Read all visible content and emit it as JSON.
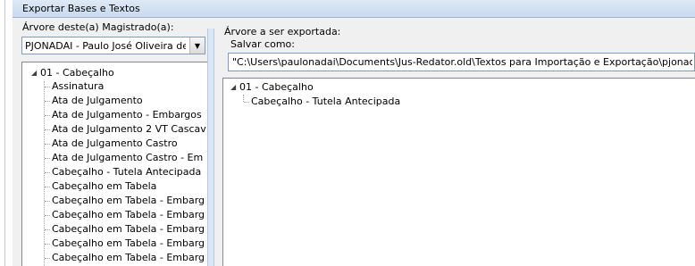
{
  "window": {
    "title": "Exportar Bases e Textos"
  },
  "left_panel": {
    "label": "Árvore deste(a) Magistrado(a):",
    "magistrate_select": {
      "value": "PJONADAI - Paulo José Oliveira de N"
    },
    "tree": {
      "root": "01 - Cabeçalho",
      "children": [
        "Assinatura",
        "Ata de Julgamento",
        "Ata de Julgamento - Embargos",
        "Ata de Julgamento 2 VT Cascav",
        "Ata de Julgamento Castro",
        "Ata de Julgamento Castro - Em",
        "Cabeçalho - Tutela Antecipada",
        "Cabeçalho em Tabela",
        "Cabeçalho em Tabela - Embarg",
        "Cabeçalho em Tabela - Embarg",
        "Cabeçalho em Tabela - Embarg",
        "Cabeçalho em Tabela - Embarg",
        "Cabeçalho em Tabela - Embarg"
      ]
    }
  },
  "right_panel": {
    "label": "Árvore a ser exportada:",
    "save_label": "Salvar como:",
    "save_path": "\"C:\\Users\\paulonadai\\Documents\\Jus-Redator.old\\Textos para Importação e Exportação\\pjonadai.rdt\"",
    "tree": {
      "root": "01 - Cabeçalho",
      "children": [
        "Cabeçalho - Tutela Antecipada"
      ]
    }
  }
}
